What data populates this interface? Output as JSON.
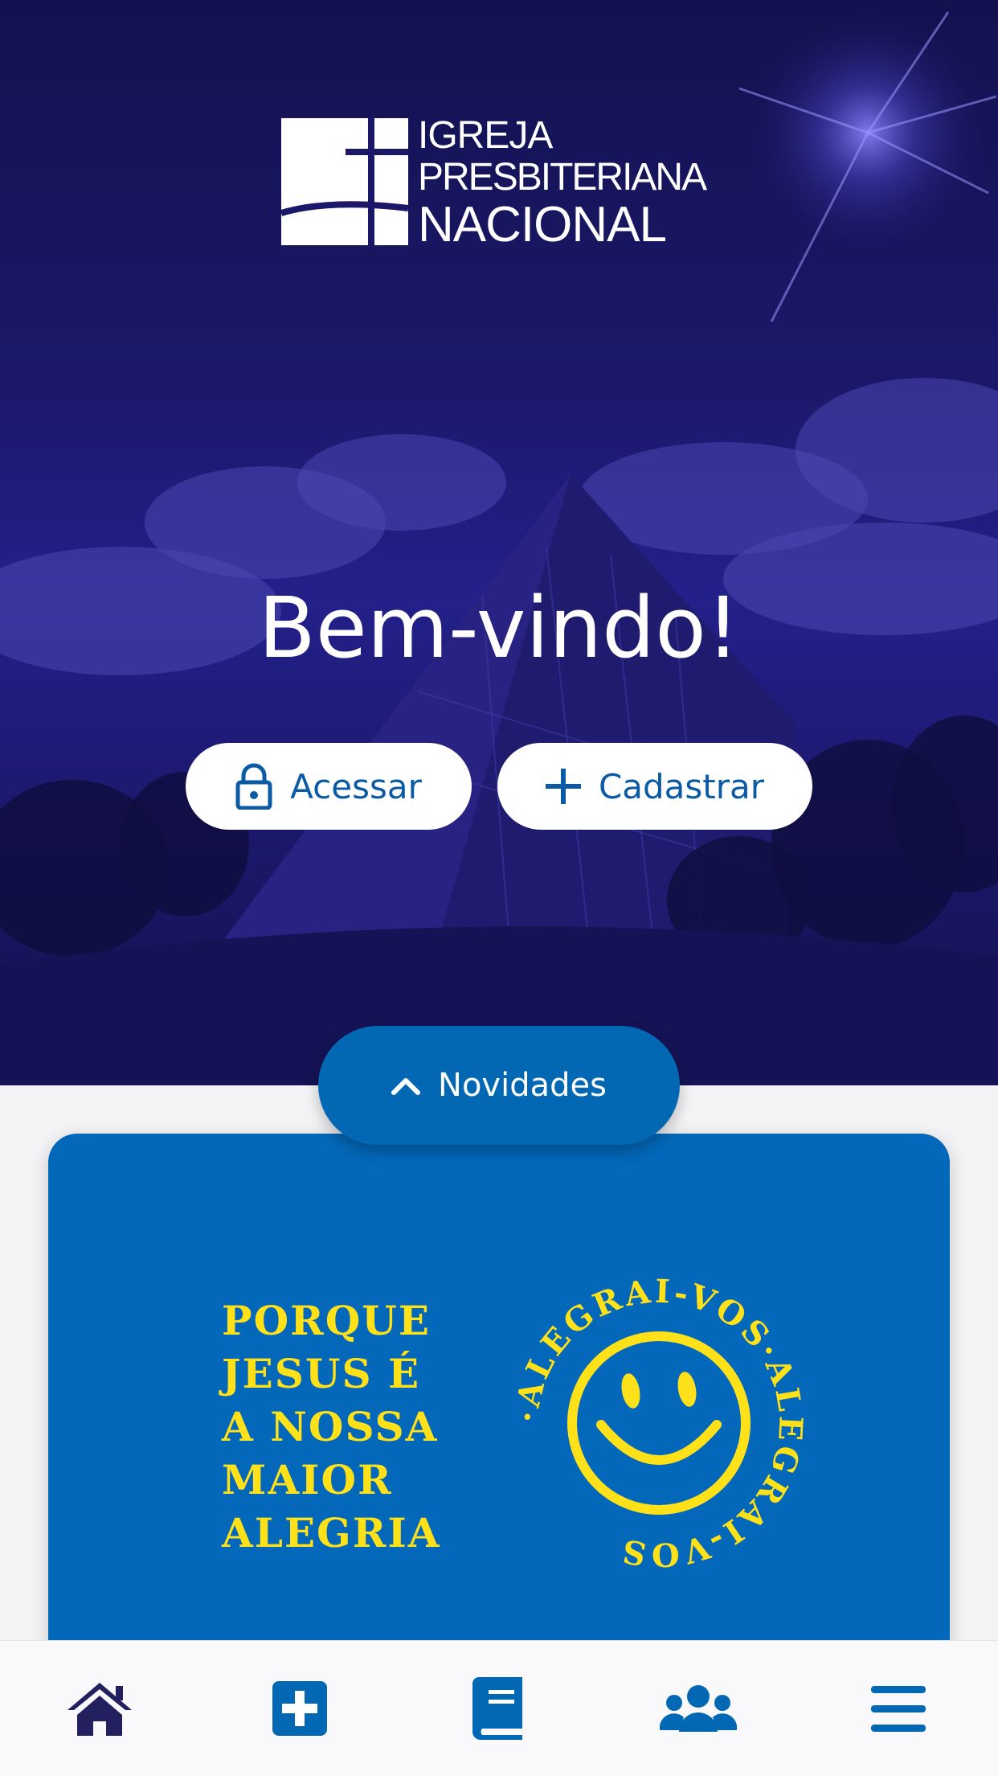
{
  "brand": {
    "line1": "IGREJA",
    "line2": "PRESBITERIANA",
    "line3": "NACIONAL"
  },
  "hero": {
    "welcome": "Bem-vindo!",
    "login_label": "Acessar",
    "register_label": "Cadastrar"
  },
  "news": {
    "toggle_label": "Novidades",
    "card": {
      "headline_lines": [
        "PORQUE",
        "JESUS É",
        "A NOSSA",
        "MAIOR",
        "ALEGRIA"
      ],
      "ring_text": "·ALEGRAI-VOS·ALEGRAI-VOS"
    }
  },
  "bottom_nav": {
    "items": [
      {
        "icon": "home-icon"
      },
      {
        "icon": "medical-plus-icon"
      },
      {
        "icon": "bible-book-icon"
      },
      {
        "icon": "community-users-icon"
      },
      {
        "icon": "menu-icon"
      }
    ]
  },
  "colors": {
    "hero_dark": "#13124f",
    "primary_blue": "#0368b4",
    "accent_yellow": "#ffe11a",
    "nav_icon_dark": "#23205f"
  }
}
